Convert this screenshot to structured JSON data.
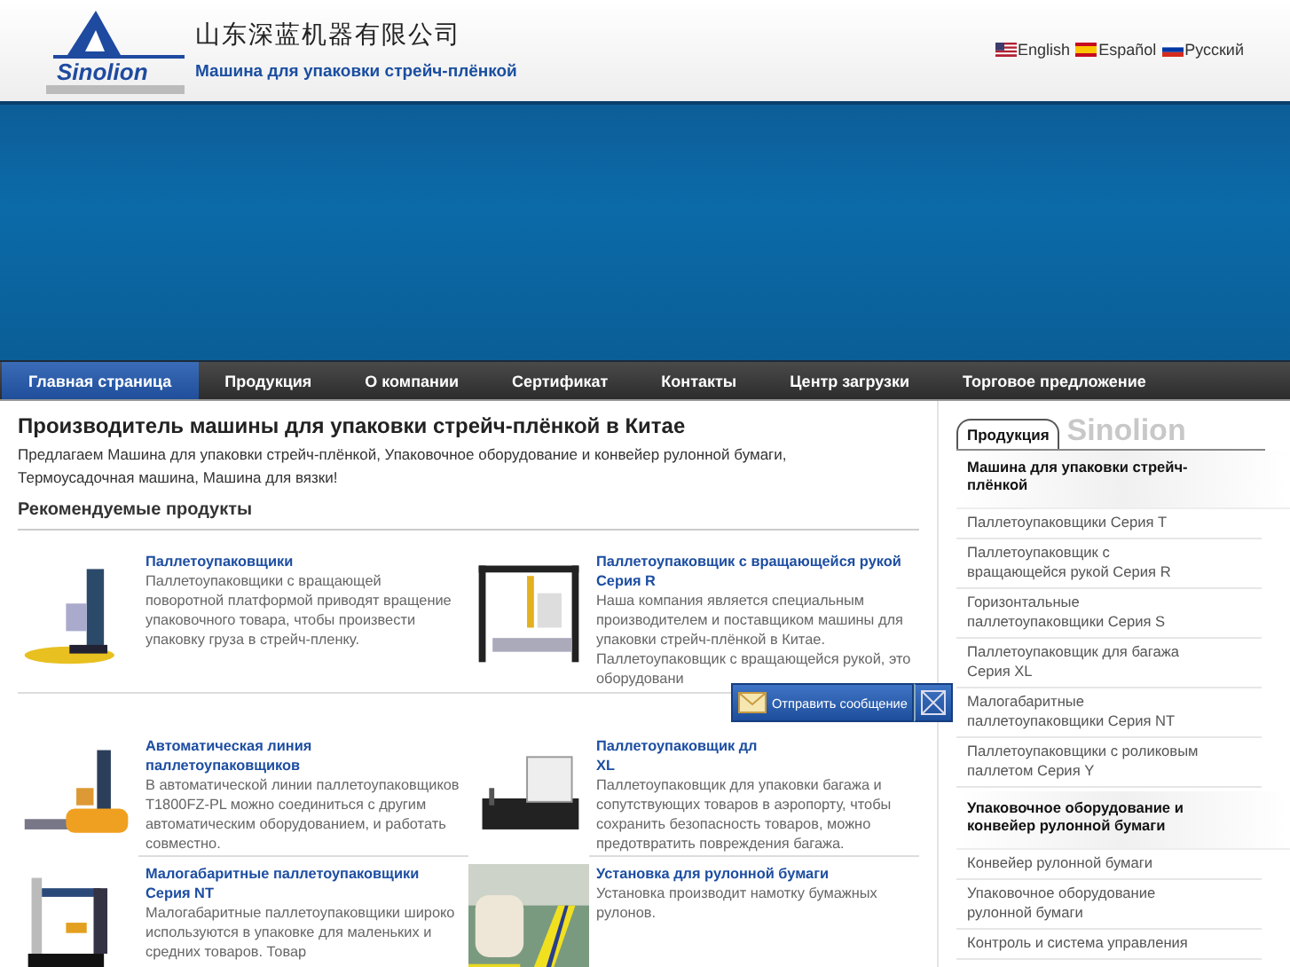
{
  "header": {
    "logo_text": "Sinolion",
    "company_name": "山东深蓝机器有限公司",
    "tagline": "Машина для упаковки стрейч-плёнкой",
    "languages": [
      {
        "label": "English"
      },
      {
        "label": "Español"
      },
      {
        "label": "Русский"
      }
    ]
  },
  "nav": [
    {
      "label": "Главная страница",
      "selected": true
    },
    {
      "label": "Продукция",
      "selected": false
    },
    {
      "label": "О компании",
      "selected": false
    },
    {
      "label": "Сертификат",
      "selected": false
    },
    {
      "label": "Контакты",
      "selected": false
    },
    {
      "label": "Центр загрузки",
      "selected": false
    },
    {
      "label": "Торговое предложение",
      "selected": false
    }
  ],
  "main": {
    "title": "Производитель машины для упаковки стрейч-плёнкой в Китае",
    "intro": "Предлагаем Машина для упаковки стрейч-плёнкой, Упаковочное оборудование и конвейер рулонной бумаги, Термоусадочная машина, Машина для вязки!",
    "section_title": "Рекомендуемые продукты",
    "products": [
      {
        "title": "Паллетоупаковщики",
        "description": "Паллетоупаковщики с вращающей поворотной платформой приводят вращение упаковочного товара, чтобы произвести упаковку груза в стрейч-пленку."
      },
      {
        "title": "Паллетоупаковщик с вращающейся рукой Серия R",
        "description": "Наша компания является специальным производителем и поставщиком машины для упаковки стрейч-плёнкой в Китае. Паллетоупаковщик с вращающейся рукой, это оборудовани"
      },
      {
        "title": "Автоматическая линия паллетоупаковщиков",
        "description": "В автоматической линии паллетоупаковщиков T1800FZ-PL можно соединиться с другим автоматическим оборудованием, и работать совместно."
      },
      {
        "title": "Паллетоупаковщик дл",
        "title_end": "XL",
        "description": "Паллетоупаковщик для упаковки багажа и сопутствующих товаров в аэропорту, чтобы сохранить безопасность товаров, можно предотвратить повреждения багажа."
      },
      {
        "title": "Малогабаритные паллетоупаковщики Серия NT",
        "description": "Малогабаритные паллетоупаковщики широко используются в упаковке для маленьких и средних товаров. Товар"
      },
      {
        "title": "Установка для рулонной бумаги",
        "description": "Установка производит намотку бумажных рулонов."
      }
    ]
  },
  "sidebar": {
    "tab": "Продукция",
    "brand_text": "Sinolion",
    "groups": [
      {
        "heading": "Машина для упаковки стрейч-плёнкой",
        "items": [
          "Паллетоупаковщики Серия T",
          "Паллетоупаковщик с вращающейся рукой Серия R",
          "Горизонтальные паллетоупаковщики Серия S",
          "Паллетоупаковщик для багажа Серия XL",
          "Малогабаритные паллетоупаковщики Серия NT",
          "Паллетоупаковщики с роликовым паллетом Серия Y"
        ]
      },
      {
        "heading": "Упаковочное оборудование и конвейер рулонной бумаги",
        "items": [
          "Конвейер рулонной бумаги",
          "Упаковочное оборудование рулонной бумаги",
          "Контроль и система управления"
        ]
      }
    ]
  },
  "message_widget": {
    "label": "Отправить сообщение"
  }
}
